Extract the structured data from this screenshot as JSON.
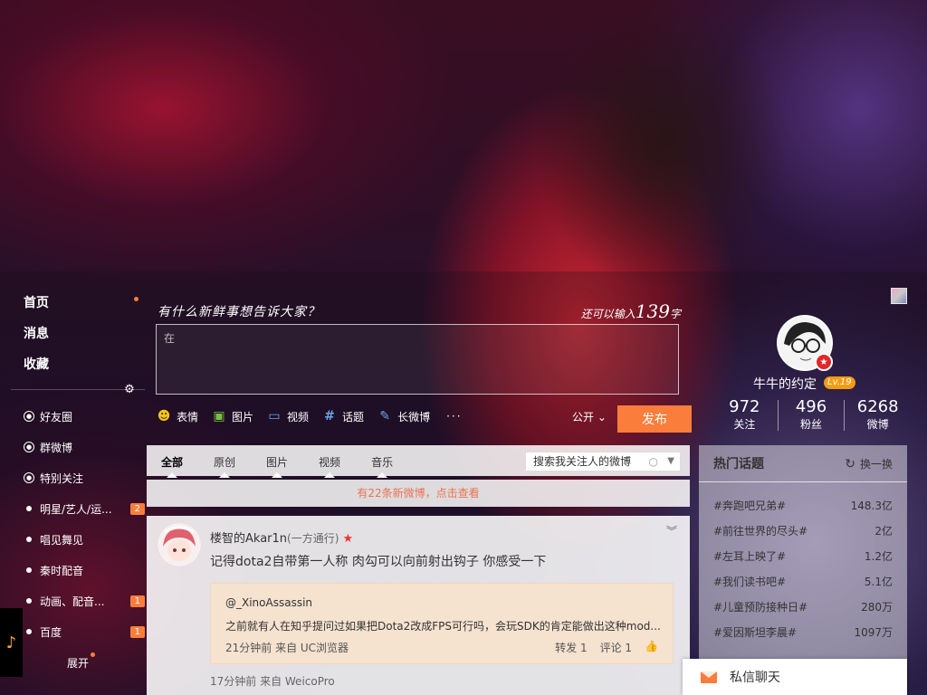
{
  "nav": {
    "home": "首页",
    "messages": "消息",
    "favorites": "收藏",
    "groups": [
      {
        "label": "好友圈",
        "icon": "friends-circle-icon"
      },
      {
        "label": "群微博",
        "icon": "group-icon"
      },
      {
        "label": "特别关注",
        "icon": "special-follow-icon"
      },
      {
        "label": "明星/艺人/运...",
        "badge": "2"
      },
      {
        "label": "唱见舞见",
        "badge": ""
      },
      {
        "label": "秦时配音",
        "badge": ""
      },
      {
        "label": "动画、配音...",
        "badge": "1"
      },
      {
        "label": "百度",
        "badge": "1"
      }
    ],
    "expand": "展开"
  },
  "composer": {
    "prompt": "有什么新鲜事想告诉大家？",
    "count_prefix": "还可以输入",
    "count": "139",
    "count_suffix": "字",
    "text": "在",
    "tools": {
      "emoji": "表情",
      "image": "图片",
      "video": "视频",
      "topic": "话题",
      "long": "长微博",
      "more": "···"
    },
    "visibility": "公开",
    "publish": "发布"
  },
  "profile": {
    "name": "牛牛的约定",
    "level": "Lv.19",
    "stats": [
      {
        "num": "972",
        "label": "关注"
      },
      {
        "num": "496",
        "label": "粉丝"
      },
      {
        "num": "6268",
        "label": "微博"
      }
    ]
  },
  "feed": {
    "tabs": [
      "全部",
      "原创",
      "图片",
      "视频",
      "音乐"
    ],
    "search_placeholder": "搜索我关注人的微博",
    "new_notice": "有22条新微博，点击查看"
  },
  "post": {
    "author": "楼智的Akar1n",
    "via": "(一方通行)",
    "text": "记得dota2自带第一人称 肉勾可以向前射出钩子 你感受一下",
    "repost": {
      "user": "@_XinoAssassin",
      "text": "之前就有人在知乎提问过如果把Dota2改成FPS可行吗，会玩SDK的肯定能做出这种mod...",
      "time": "21分钟前 来自 UC浏览器",
      "forward": "转发 1",
      "comment": "评论 1"
    },
    "meta": "17分钟前 来自 WeicoPro"
  },
  "hot": {
    "title": "热门话题",
    "refresh": "换一换",
    "topics": [
      {
        "name": "#奔跑吧兄弟#",
        "count": "148.3亿"
      },
      {
        "name": "#前往世界的尽头#",
        "count": "2亿"
      },
      {
        "name": "#左耳上映了#",
        "count": "1.2亿"
      },
      {
        "name": "#我们读书吧#",
        "count": "5.1亿"
      },
      {
        "name": "#儿童预防接种日#",
        "count": "280万"
      },
      {
        "name": "#爱因斯坦李晨#",
        "count": "1097万"
      }
    ]
  },
  "chat": {
    "label": "私信聊天"
  },
  "colors": {
    "accent": "#fa7d3c",
    "notice": "#eb7350",
    "badge": "#fa7d3c"
  }
}
